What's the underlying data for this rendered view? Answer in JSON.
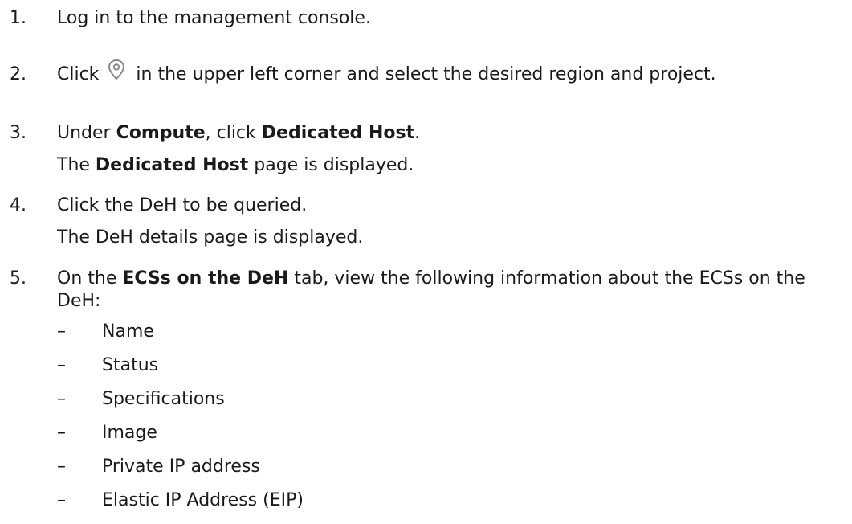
{
  "steps": [
    {
      "num": "1.",
      "text": "Log in to the management console."
    },
    {
      "num": "2.",
      "pre": "Click",
      "icon": "location-pin-icon",
      "post": "in the upper left corner and select the desired region and project."
    },
    {
      "num": "3.",
      "p1": "Under ",
      "b1": "Compute",
      "p2": ", click ",
      "b2": "Dedicated Host",
      "p3": ".",
      "sub_b": "Dedicated Host",
      "sub_p": " page is displayed.",
      "sub_pre": "The "
    },
    {
      "num": "4.",
      "text": "Click the DeH to be queried.",
      "sub": "The DeH details page is displayed."
    },
    {
      "num": "5.",
      "p1": "On the ",
      "b1": "ECSs on the DeH",
      "p2": " tab, view the following information about the ECSs on the DeH:"
    }
  ],
  "dash": "–",
  "bullets": [
    "Name",
    "Status",
    "Specifications",
    "Image",
    "Private IP address",
    "Elastic IP Address (EIP)"
  ]
}
